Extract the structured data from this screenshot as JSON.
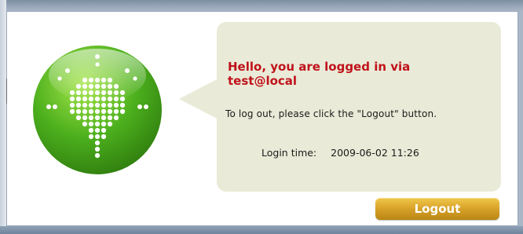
{
  "message": {
    "greeting_line1": "Hello, you are logged in via",
    "greeting_line2": "test@local",
    "instruction": "To log out, please click the \"Logout\" button.",
    "login_time_label": "Login time:",
    "login_time_value": "2009-06-02 11:26"
  },
  "actions": {
    "logout_label": "Logout"
  },
  "icons": {
    "logo": "green-arrow-logo-icon"
  },
  "colors": {
    "greeting": "#c0121b",
    "bubble": "#e9ebd8",
    "logo_green": "#4caf1d",
    "button_gold": "#dba52b"
  }
}
